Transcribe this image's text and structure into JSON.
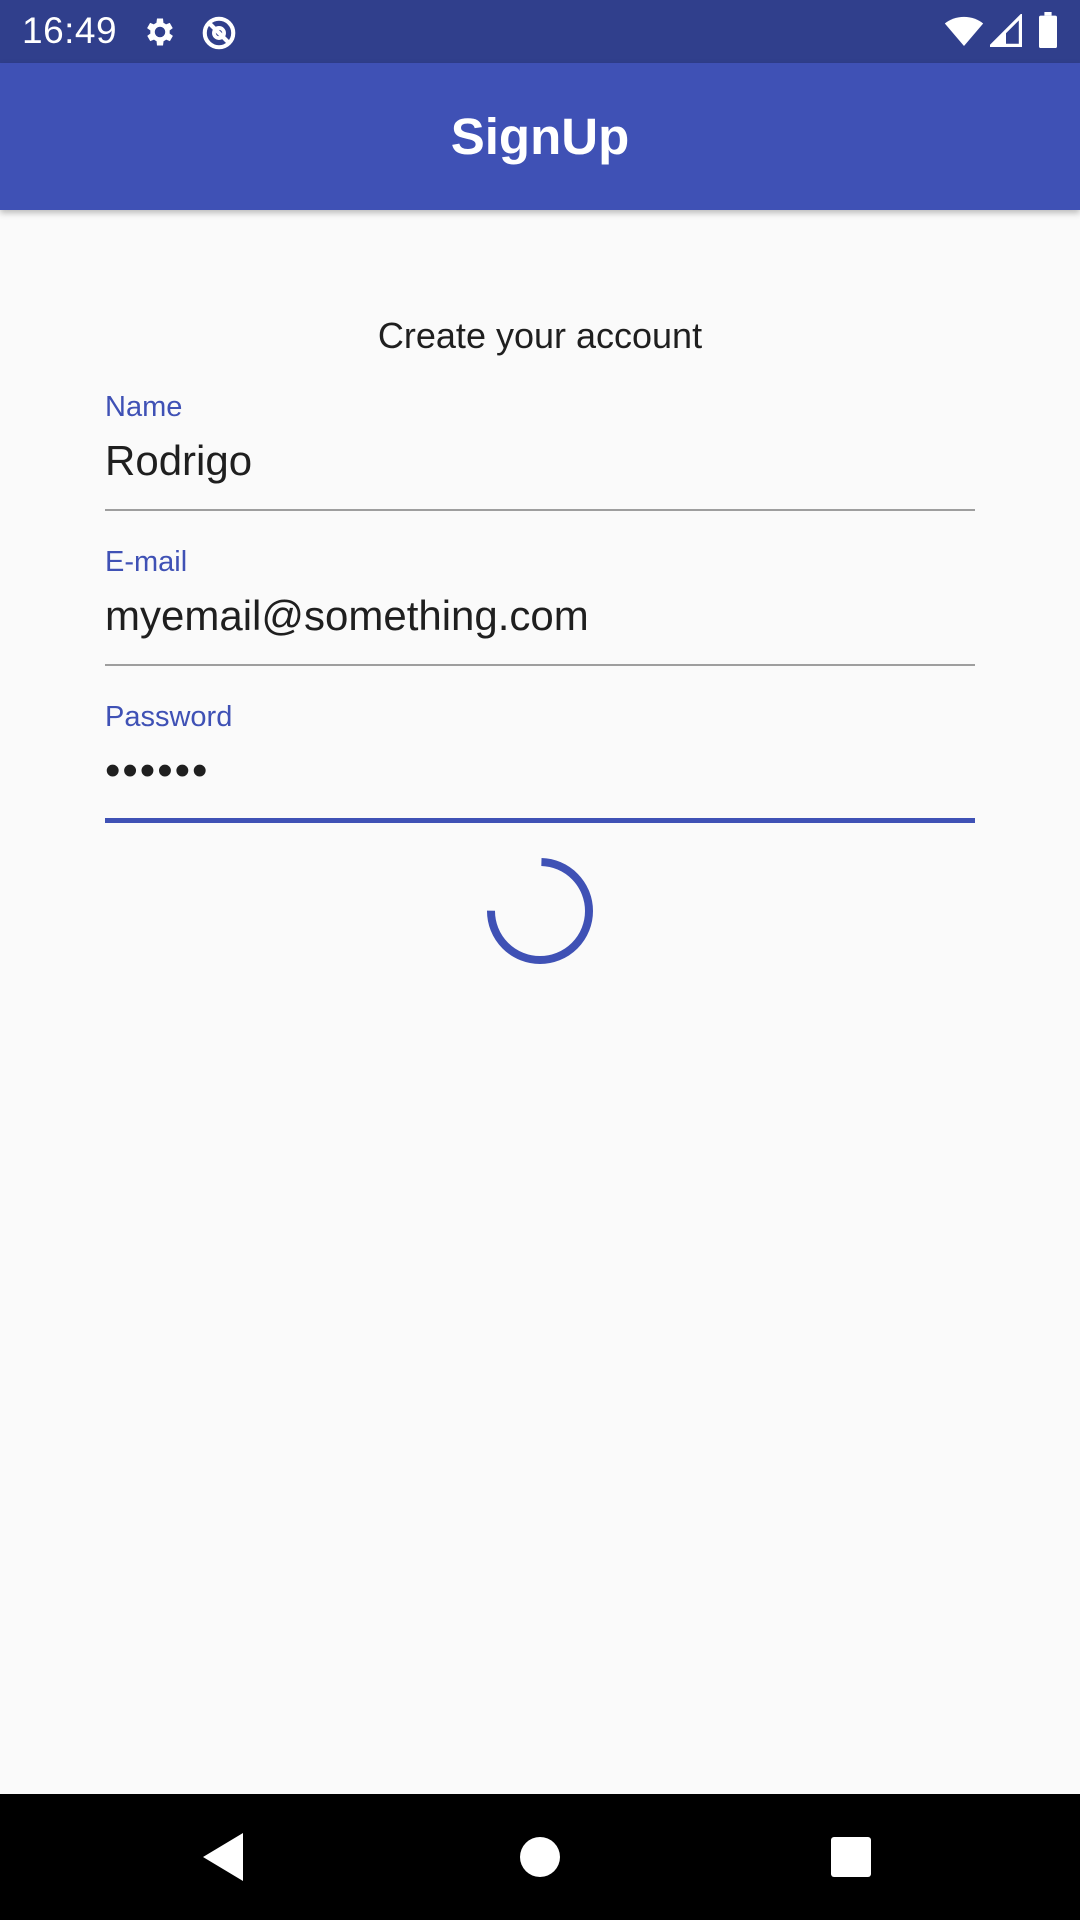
{
  "status_bar": {
    "time": "16:49",
    "icons": [
      "gear-icon",
      "sync-blocked-icon",
      "wifi-icon",
      "signal-icon",
      "battery-icon"
    ]
  },
  "app_bar": {
    "title": "SignUp",
    "color": "#3f51b5"
  },
  "form": {
    "subtitle": "Create your account",
    "fields": [
      {
        "label": "Name",
        "value": "Rodrigo"
      },
      {
        "label": "E-mail",
        "value": "myemail@something.com"
      },
      {
        "label": "Password",
        "value": "••••••",
        "focused": true
      }
    ],
    "loading": true
  },
  "nav_bar": {
    "buttons": [
      "back-icon",
      "home-icon",
      "recents-icon"
    ]
  },
  "colors": {
    "status_bar": "#303f8c",
    "primary": "#3f51b5",
    "background": "#fafafa"
  }
}
